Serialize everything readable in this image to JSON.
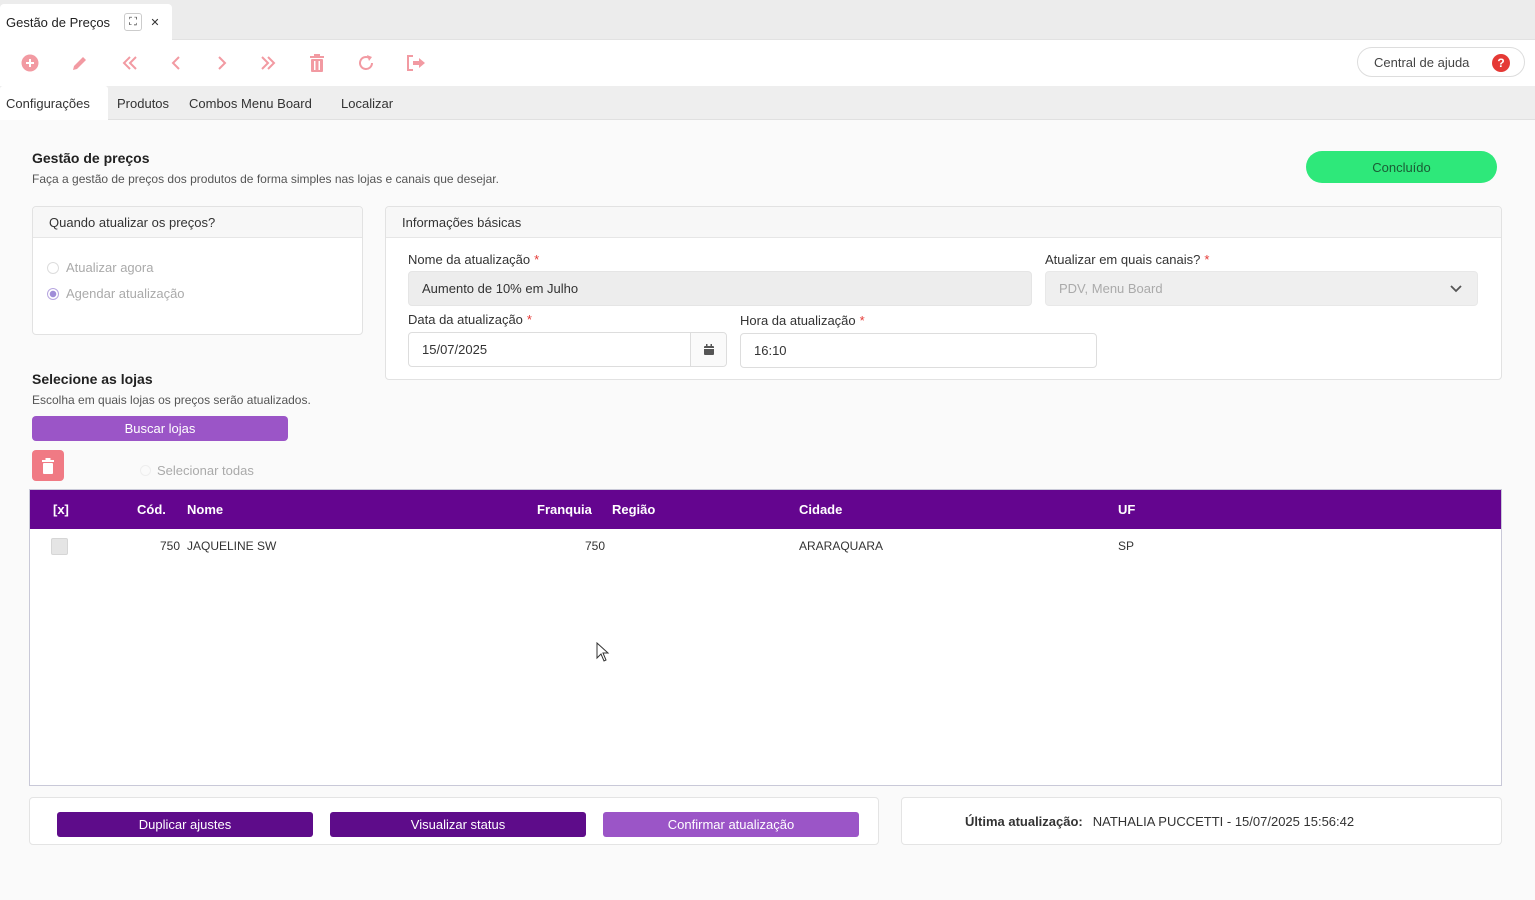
{
  "tab": {
    "title": "Gestão de Preços"
  },
  "toolbar": {
    "help_label": "Central de ajuda",
    "help_icon": "?"
  },
  "navtabs": [
    "Configurações",
    "Produtos",
    "Combos Menu Board",
    "Localizar"
  ],
  "header": {
    "title": "Gestão de preços",
    "subtitle": "Faça a gestão de preços dos produtos de forma simples nas lojas e canais que desejar.",
    "done_label": "Concluído"
  },
  "when_panel": {
    "title": "Quando atualizar os preços?",
    "options": [
      "Atualizar agora",
      "Agendar atualização"
    ],
    "selected": "Agendar atualização"
  },
  "info_panel": {
    "title": "Informações básicas",
    "name_label": "Nome da atualização",
    "name_value": "Aumento de 10% em Julho",
    "channels_label": "Atualizar em quais canais?",
    "channels_value": "PDV, Menu Board",
    "date_label": "Data da atualização",
    "date_value": "15/07/2025",
    "time_label": "Hora da atualização",
    "time_value": "16:10",
    "required_mark": "*"
  },
  "stores": {
    "title": "Selecione as lojas",
    "subtitle": "Escolha em quais lojas os preços serão atualizados.",
    "search_label": "Buscar lojas",
    "select_all_label": "Selecionar todas",
    "columns": [
      "[x]",
      "Cód.",
      "Nome",
      "Franquia",
      "Região",
      "Cidade",
      "UF"
    ],
    "rows": [
      {
        "cod": "750",
        "nome": "JAQUELINE SW",
        "franquia": "750",
        "regiao": "",
        "cidade": "ARARAQUARA",
        "uf": "SP"
      }
    ]
  },
  "footer": {
    "duplicate_label": "Duplicar ajustes",
    "status_label": "Visualizar status",
    "confirm_label": "Confirmar atualização",
    "last_update_label": "Última atualização:",
    "last_update_value": "NATHALIA PUCCETTI - 15/07/2025 15:56:42"
  },
  "colors": {
    "primary": "#64058f",
    "primary_light": "#9b55c7",
    "success": "#2ee87a",
    "danger": "#f07a84",
    "toolbar_icon": "#f29aa2"
  }
}
